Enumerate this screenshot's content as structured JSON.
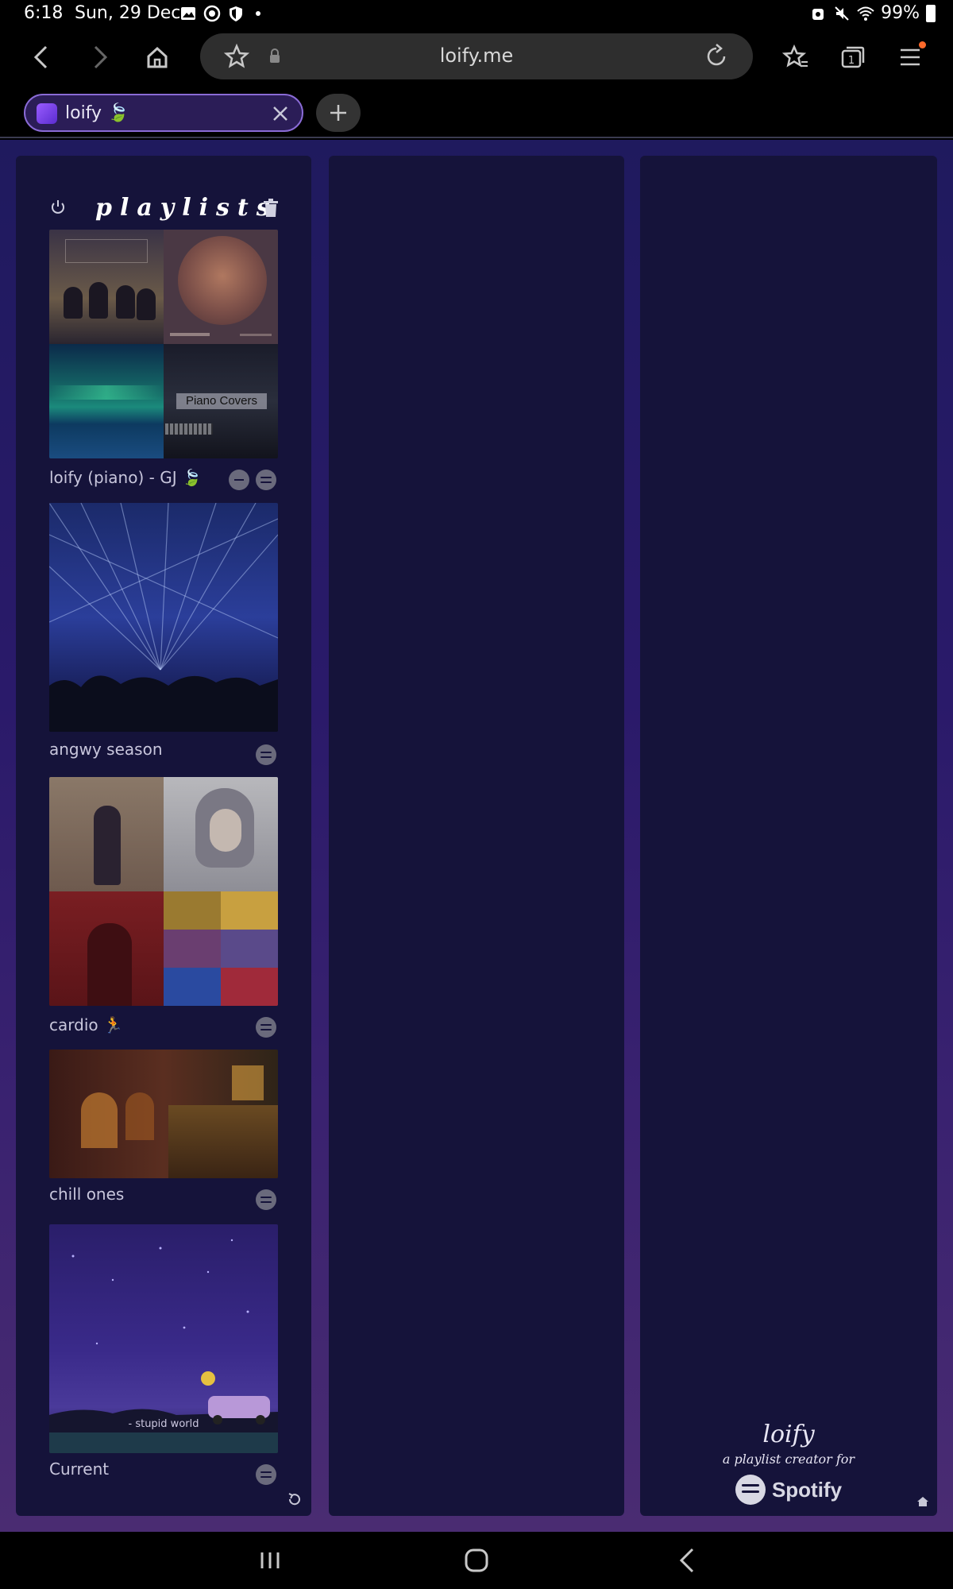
{
  "status_bar": {
    "time": "6:18",
    "date": "Sun, 29 Dec",
    "battery": "99%",
    "icons": [
      "gallery-icon",
      "sync-icon",
      "shield-icon",
      "dot",
      "alarm-icon",
      "mute-icon",
      "wifi-icon",
      "battery-icon"
    ]
  },
  "browser": {
    "url": "loify.me",
    "tab_title": "loify 🍃",
    "icons": [
      "back-icon",
      "forward-icon",
      "home-icon",
      "star-icon",
      "lock-icon",
      "reload-icon",
      "bookmarks-icon",
      "tabs-icon",
      "menu-icon",
      "close-icon",
      "plus-icon"
    ]
  },
  "panel": {
    "title": "playlists"
  },
  "playlists": [
    {
      "name": "loify (piano) - GJ 🍃",
      "overlay_text": "Piano Covers"
    },
    {
      "name": "angwy season"
    },
    {
      "name": "cardio 🏃"
    },
    {
      "name": "chill ones"
    },
    {
      "name": "Current",
      "overlay_text": "- stupid world"
    }
  ],
  "credit": {
    "brand": "loify",
    "tagline": "a playlist creator for",
    "service": "Spotify"
  },
  "colors": {
    "panel_bg": "#15133a",
    "page_top": "#1f1a5e",
    "page_bottom": "#4a2c72",
    "tab_border": "#8a6bd6",
    "notification_dot": "#ff6a2b"
  }
}
